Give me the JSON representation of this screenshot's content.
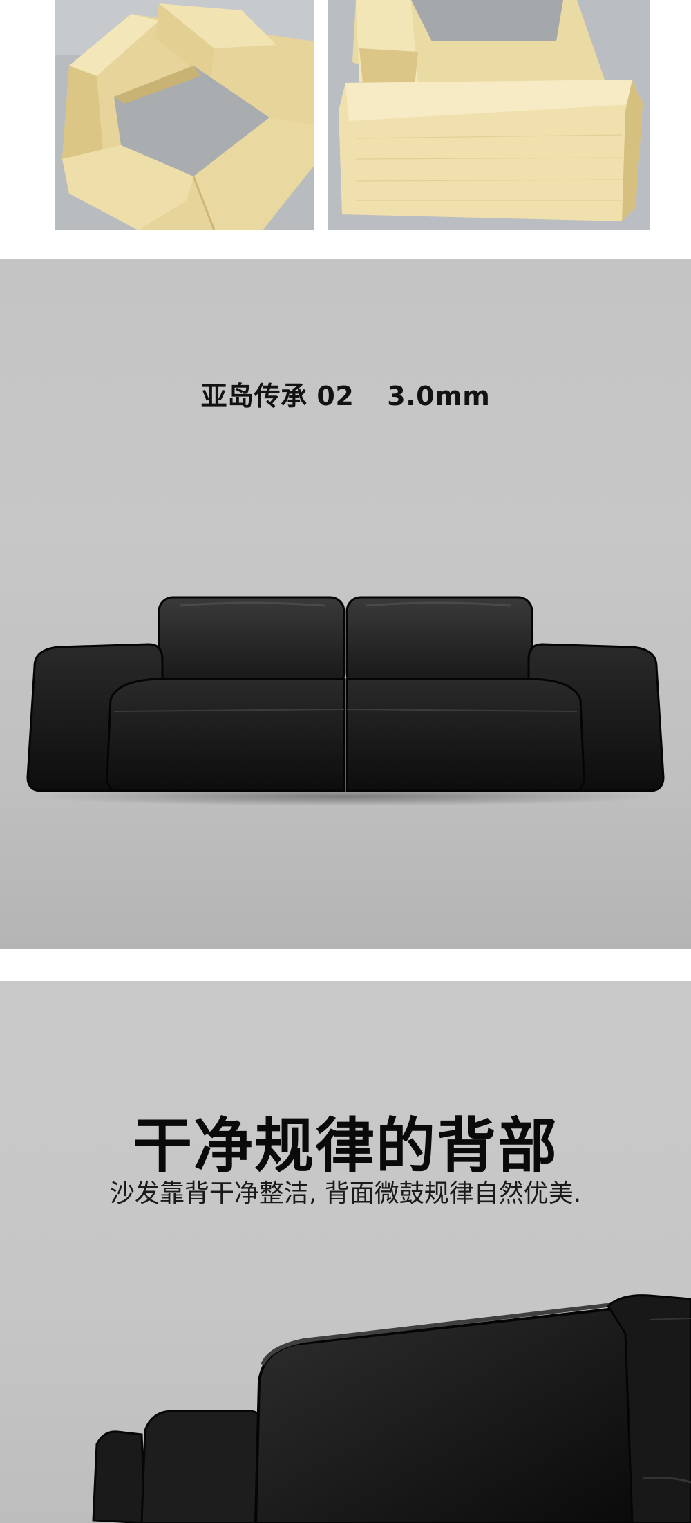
{
  "product": {
    "caption_name": "亚岛传承 02",
    "caption_thickness": "3.0mm"
  },
  "back_detail": {
    "title": "干净规律的背部",
    "subtitle": "沙发靠背干净整洁, 背面微鼓规律自然优美."
  },
  "colors": {
    "wood": "#eedfaa",
    "wood_shadow": "#d9c58a",
    "floor": "#b9bdc0",
    "leather": "#141414",
    "background_gray": "#c6c6c6"
  }
}
